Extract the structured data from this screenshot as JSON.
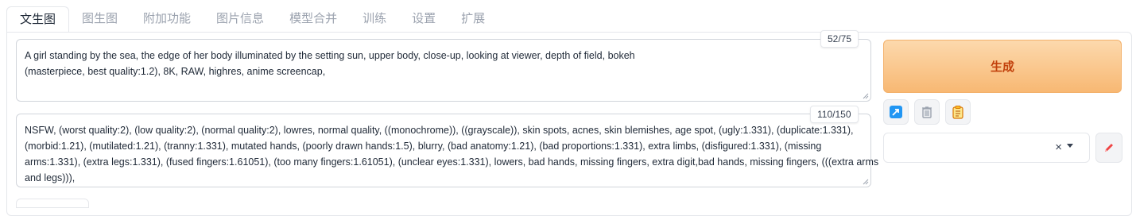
{
  "tabs": [
    {
      "label": "文生图",
      "active": true
    },
    {
      "label": "图生图"
    },
    {
      "label": "附加功能"
    },
    {
      "label": "图片信息"
    },
    {
      "label": "模型合并"
    },
    {
      "label": "训练"
    },
    {
      "label": "设置"
    },
    {
      "label": "扩展"
    }
  ],
  "prompt": {
    "counter": "52/75",
    "lines": [
      "A girl standing by the sea, the edge of her body illuminated by the setting sun, upper body, close-up, looking at viewer, depth of field, bokeh",
      "(masterpiece, best quality:1.2), 8K, RAW, highres, anime screencap,"
    ]
  },
  "negative_prompt": {
    "counter": "110/150",
    "lines": [
      "NSFW, (worst quality:2), (low quality:2), (normal quality:2), lowres, normal quality, ((monochrome)), ((grayscale)), skin spots, acnes, skin blemishes, age spot, (ugly:1.331), (duplicate:1.331),",
      "(morbid:1.21), (mutilated:1.21), (tranny:1.331), mutated hands, (poorly drawn hands:1.5), blurry, (bad anatomy:1.21), (bad proportions:1.331), extra limbs, (disfigured:1.331), (missing",
      "arms:1.331), (extra legs:1.331), (fused fingers:1.61051), (too many fingers:1.61051), (unclear eyes:1.331), lowers, bad hands, missing fingers, extra digit,bad hands, missing fingers, (((extra arms",
      "and legs))),"
    ]
  },
  "generate": {
    "label": "生成"
  },
  "style_dropdown": {
    "clear_symbol": "×"
  },
  "colors": {
    "accent_orange": "#f8b873",
    "generate_text": "#c2410c",
    "checkbox_blue": "#2563eb"
  }
}
